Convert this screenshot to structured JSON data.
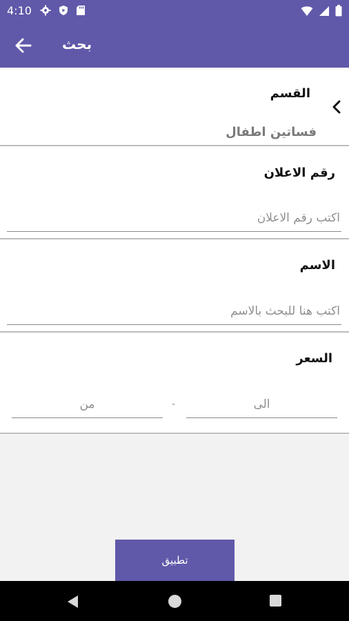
{
  "status_bar": {
    "time": "4:10",
    "icons_left": [
      "settings-icon",
      "shield-icon",
      "sd-card-icon"
    ],
    "icons_right": [
      "wifi-icon",
      "signal-icon",
      "battery-icon"
    ]
  },
  "app_bar": {
    "title": "بحث",
    "back_icon": "arrow-back-icon",
    "color": "#6059a9"
  },
  "form": {
    "category": {
      "label": "القسم",
      "value": "فساتين اطفال",
      "icon": "chevron-left-icon"
    },
    "ad_number": {
      "label": "رقم الاعلان",
      "placeholder": "اكتب رقم الاعلان"
    },
    "name": {
      "label": "الاسم",
      "placeholder": "اكتب هنا للبحث بالاسم"
    },
    "price": {
      "label": "السعر",
      "to_placeholder": "الى",
      "from_placeholder": "من",
      "separator": "-"
    }
  },
  "apply_button": {
    "label": "تطبيق"
  },
  "nav_bar": {
    "icons": [
      "nav-back-icon",
      "nav-home-icon",
      "nav-recents-icon"
    ]
  }
}
